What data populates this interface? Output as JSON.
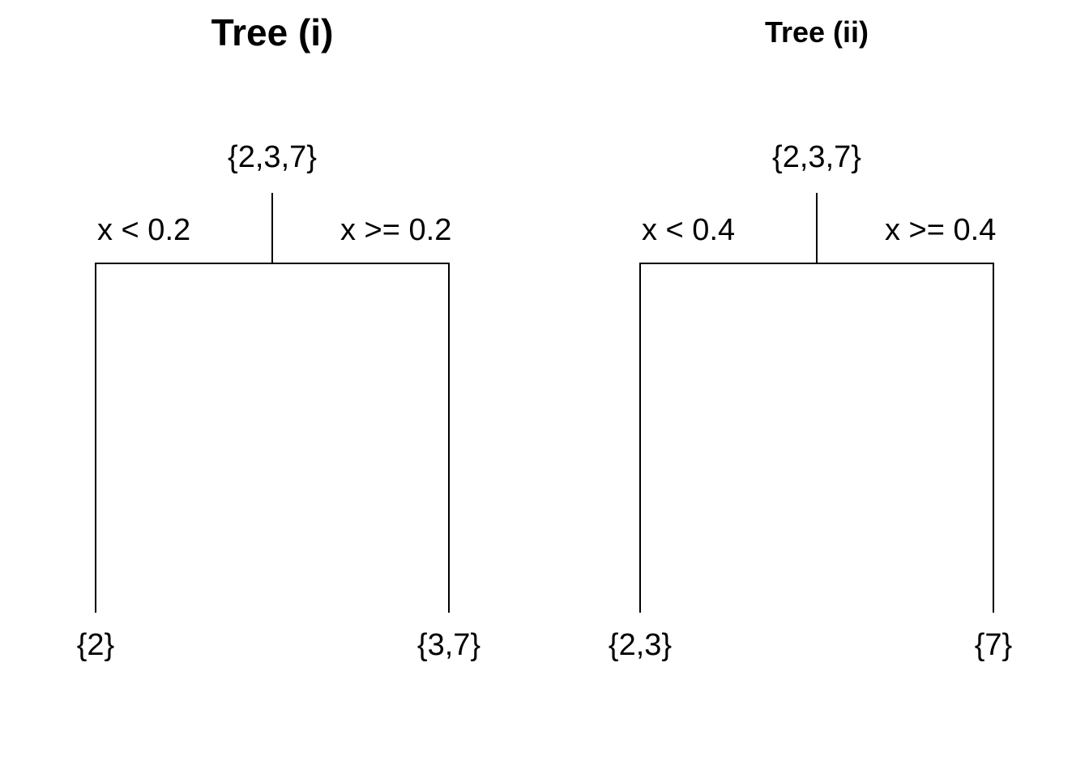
{
  "trees": [
    {
      "title": "Tree (i)",
      "root": "{2,3,7}",
      "split_left": "x < 0.2",
      "split_right": "x >= 0.2",
      "leaf_left": "{2}",
      "leaf_right": "{3,7}"
    },
    {
      "title": "Tree (ii)",
      "root": "{2,3,7}",
      "split_left": "x < 0.4",
      "split_right": "x >= 0.4",
      "leaf_left": "{2,3}",
      "leaf_right": "{7}"
    }
  ]
}
